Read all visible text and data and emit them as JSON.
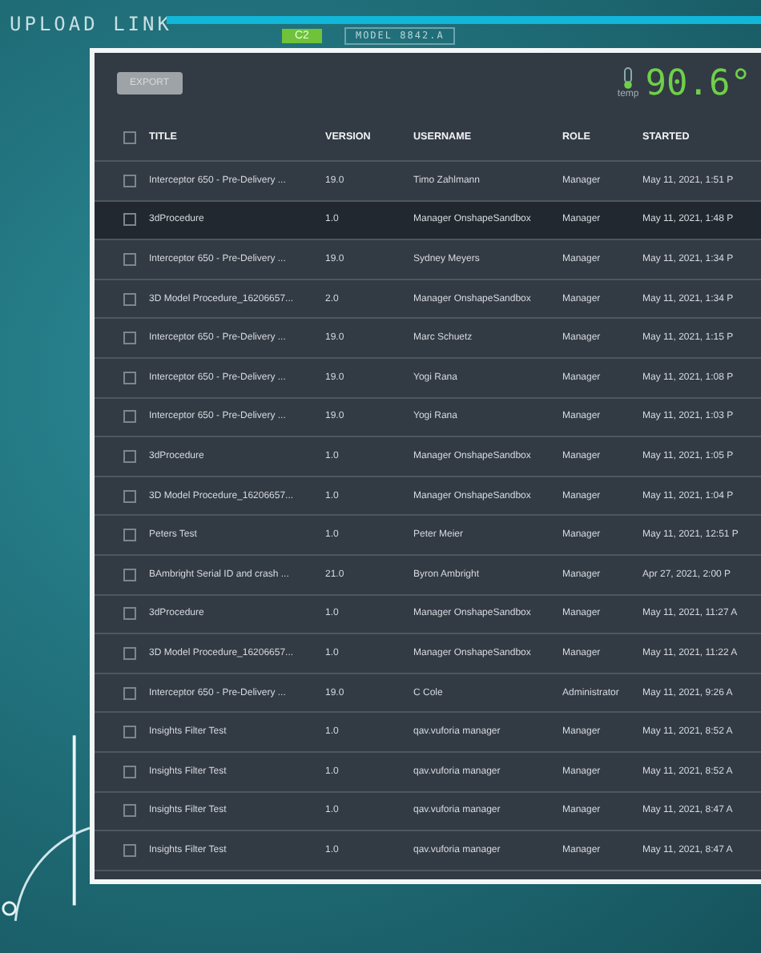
{
  "hud": {
    "title": "UPLOAD LINK",
    "badge": "C2",
    "model": "MODEL 8842.A",
    "temp_label": "temp",
    "temp_reading": "90.6°"
  },
  "toolbar": {
    "export_button": {
      "label": "EXPORT",
      "disabled": true
    }
  },
  "table": {
    "header_checked": false,
    "columns": [
      "TITLE",
      "VERSION",
      "USERNAME",
      "ROLE",
      "STARTED"
    ],
    "rows": [
      {
        "checked": false,
        "selected": false,
        "cells": [
          "Interceptor 650 - Pre-Delivery ...",
          "19.0",
          "Timo Zahlmann",
          "Manager",
          "May 11, 2021, 1:51 P"
        ]
      },
      {
        "checked": false,
        "selected": true,
        "cells": [
          "3dProcedure",
          "1.0",
          "Manager OnshapeSandbox",
          "Manager",
          "May 11, 2021, 1:48 P"
        ]
      },
      {
        "checked": false,
        "selected": false,
        "cells": [
          "Interceptor 650 - Pre-Delivery ...",
          "19.0",
          "Sydney Meyers",
          "Manager",
          "May 11, 2021, 1:34 P"
        ]
      },
      {
        "checked": false,
        "selected": false,
        "cells": [
          "3D Model Procedure_16206657...",
          "2.0",
          "Manager OnshapeSandbox",
          "Manager",
          "May 11, 2021, 1:34 P"
        ]
      },
      {
        "checked": false,
        "selected": false,
        "cells": [
          "Interceptor 650 - Pre-Delivery ...",
          "19.0",
          "Marc Schuetz",
          "Manager",
          "May 11, 2021, 1:15 P"
        ]
      },
      {
        "checked": false,
        "selected": false,
        "cells": [
          "Interceptor 650 - Pre-Delivery ...",
          "19.0",
          "Yogi Rana",
          "Manager",
          "May 11, 2021, 1:08 P"
        ]
      },
      {
        "checked": false,
        "selected": false,
        "cells": [
          "Interceptor 650 - Pre-Delivery ...",
          "19.0",
          "Yogi Rana",
          "Manager",
          "May 11, 2021, 1:03 P"
        ]
      },
      {
        "checked": false,
        "selected": false,
        "cells": [
          "3dProcedure",
          "1.0",
          "Manager OnshapeSandbox",
          "Manager",
          "May 11, 2021, 1:05 P"
        ]
      },
      {
        "checked": false,
        "selected": false,
        "cells": [
          "3D Model Procedure_16206657...",
          "1.0",
          "Manager OnshapeSandbox",
          "Manager",
          "May 11, 2021, 1:04 P"
        ]
      },
      {
        "checked": false,
        "selected": false,
        "cells": [
          "Peters Test",
          "1.0",
          "Peter Meier",
          "Manager",
          "May 11, 2021, 12:51 P"
        ]
      },
      {
        "checked": false,
        "selected": false,
        "cells": [
          "BAmbright Serial ID and crash ...",
          "21.0",
          "Byron Ambright",
          "Manager",
          "Apr 27, 2021, 2:00 P"
        ]
      },
      {
        "checked": false,
        "selected": false,
        "cells": [
          "3dProcedure",
          "1.0",
          "Manager OnshapeSandbox",
          "Manager",
          "May 11, 2021, 11:27 A"
        ]
      },
      {
        "checked": false,
        "selected": false,
        "cells": [
          "3D Model Procedure_16206657...",
          "1.0",
          "Manager OnshapeSandbox",
          "Manager",
          "May 11, 2021, 11:22 A"
        ]
      },
      {
        "checked": false,
        "selected": false,
        "cells": [
          "Interceptor 650 - Pre-Delivery ...",
          "19.0",
          "C Cole",
          "Administrator",
          "May 11, 2021, 9:26 A"
        ]
      },
      {
        "checked": false,
        "selected": false,
        "cells": [
          "Insights Filter Test",
          "1.0",
          "qav.vuforia manager",
          "Manager",
          "May 11, 2021, 8:52 A"
        ]
      },
      {
        "checked": false,
        "selected": false,
        "cells": [
          "Insights Filter Test",
          "1.0",
          "qav.vuforia manager",
          "Manager",
          "May 11, 2021, 8:52 A"
        ]
      },
      {
        "checked": false,
        "selected": false,
        "cells": [
          "Insights Filter Test",
          "1.0",
          "qav.vuforia manager",
          "Manager",
          "May 11, 2021, 8:47 A"
        ]
      },
      {
        "checked": false,
        "selected": false,
        "cells": [
          "Insights Filter Test",
          "1.0",
          "qav.vuforia manager",
          "Manager",
          "May 11, 2021, 8:47 A"
        ]
      }
    ]
  }
}
